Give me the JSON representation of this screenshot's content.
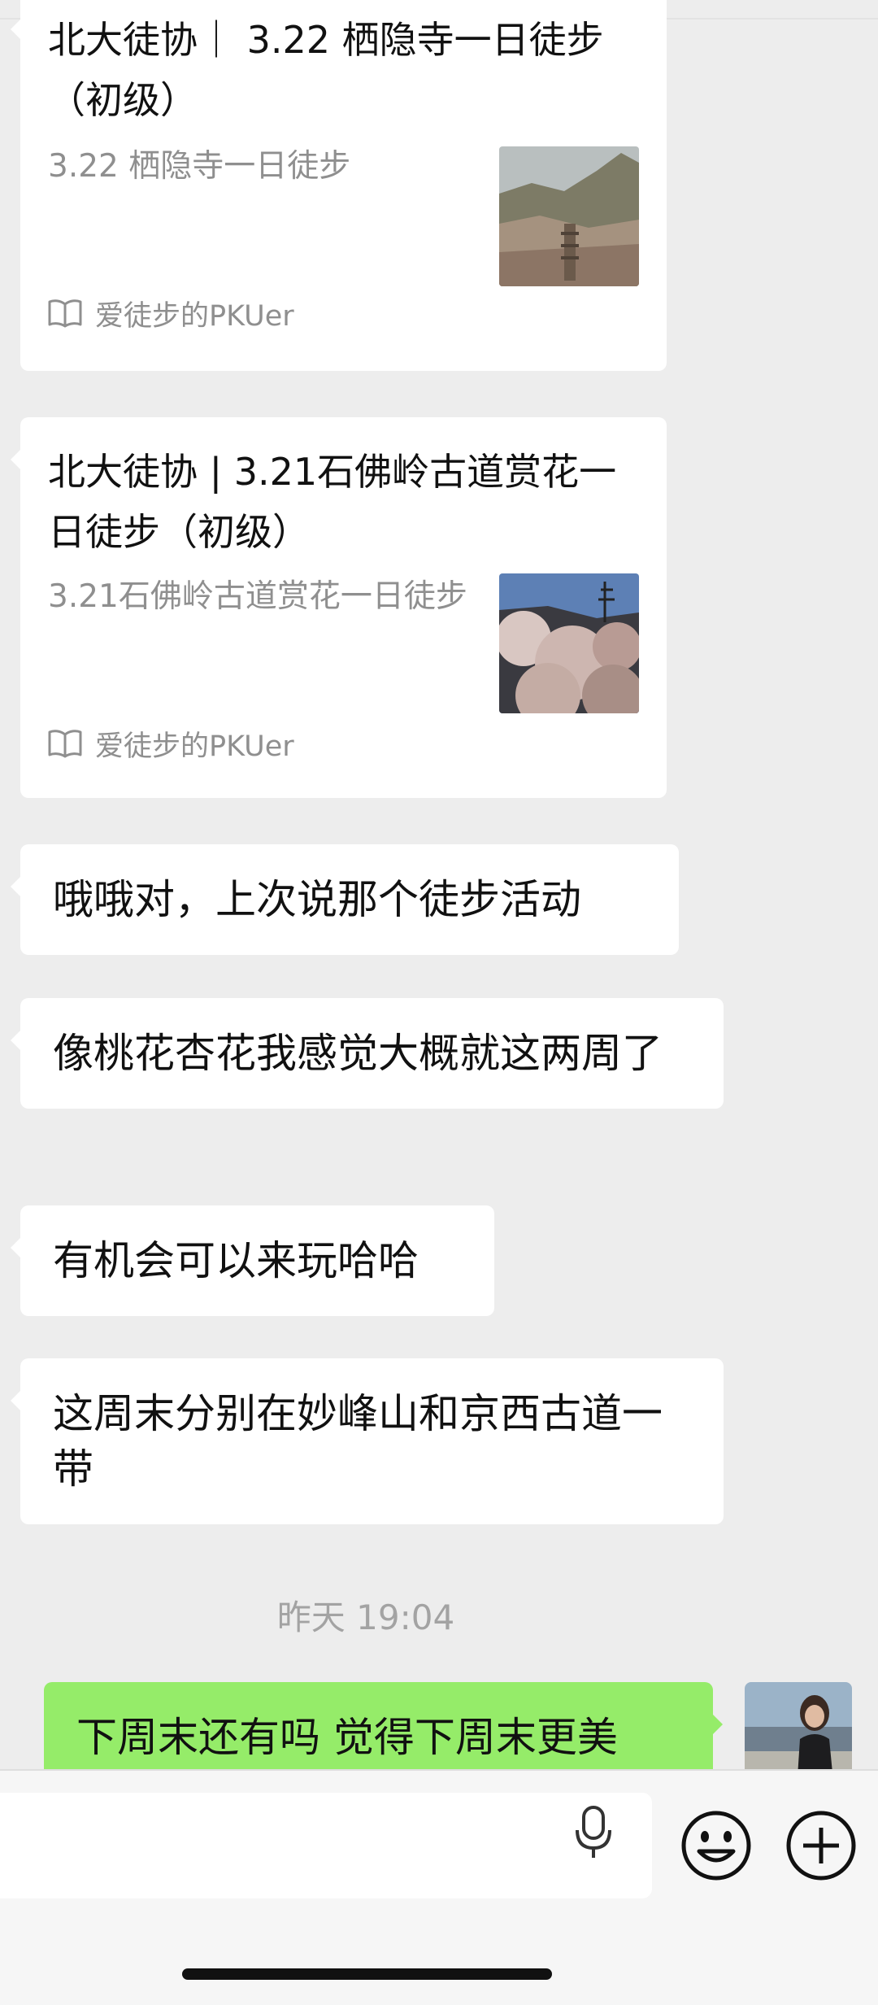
{
  "articles": [
    {
      "title": "北大徒协｜ 3.22 栖隐寺一日徒步（初级）",
      "description": "3.22 栖隐寺一日徒步",
      "source": "爱徒步的PKUer",
      "thumbnail": "mountain-pagoda-photo"
    },
    {
      "title": "北大徒协 | 3.21石佛岭古道赏花一日徒步（初级）",
      "description": "3.21石佛岭古道赏花一日徒步",
      "source": "爱徒步的PKUer",
      "thumbnail": "blossom-tower-photo"
    }
  ],
  "messages": [
    {
      "side": "left",
      "text": "哦哦对，上次说那个徒步活动"
    },
    {
      "side": "left",
      "text": "像桃花杏花我感觉大概就这两周了"
    },
    {
      "side": "left",
      "text": "有机会可以来玩哈哈"
    },
    {
      "side": "left",
      "text": "这周末分别在妙峰山和京西古道一带"
    },
    {
      "side": "right",
      "text": "下周末还有吗 觉得下周末更美"
    }
  ],
  "timestamp": "昨天 19:04",
  "input": {
    "value": "",
    "icons": [
      "mic-icon",
      "emoji-icon",
      "plus-icon"
    ]
  },
  "colors": {
    "background": "#ededed",
    "bubble_self": "#95ec69",
    "bubble_other": "#ffffff",
    "meta_text": "#8f8f8f"
  }
}
